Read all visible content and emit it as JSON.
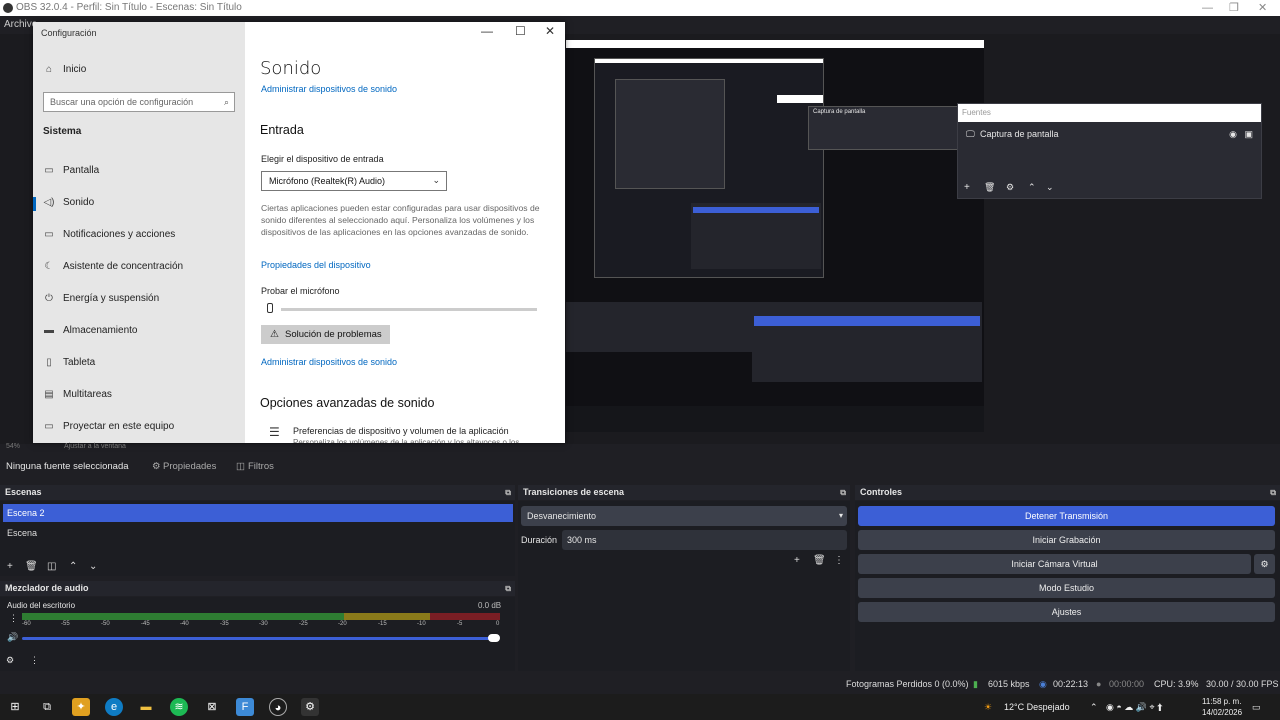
{
  "obs": {
    "window_title": "OBS 32.0.4 - Perfil: Sin Título - Escenas: Sin Título",
    "menu_first": "Archivo",
    "preview_sources_title": "Fuentes",
    "preview_source_item": "Captura de pantalla",
    "no_source": "Ninguna fuente seleccionada",
    "properties": "Propiedades",
    "filters": "Filtros",
    "scale_hint": "54%",
    "fit_hint": "Ajustar a la ventana"
  },
  "settings": {
    "window_title": "Configuración",
    "home": "Inicio",
    "search_placeholder": "Buscar una opción de configuración",
    "section": "Sistema",
    "side_items": [
      {
        "label": "Pantalla",
        "icon": "monitor-icon"
      },
      {
        "label": "Sonido",
        "icon": "speaker-icon"
      },
      {
        "label": "Notificaciones y acciones",
        "icon": "notification-icon"
      },
      {
        "label": "Asistente de concentración",
        "icon": "moon-icon"
      },
      {
        "label": "Energía y suspensión",
        "icon": "power-icon"
      },
      {
        "label": "Almacenamiento",
        "icon": "storage-icon"
      },
      {
        "label": "Tableta",
        "icon": "tablet-icon"
      },
      {
        "label": "Multitareas",
        "icon": "multitask-icon"
      },
      {
        "label": "Proyectar en este equipo",
        "icon": "project-icon"
      }
    ],
    "page_title": "Sonido",
    "manage_devices_top": "Administrar dispositivos de sonido",
    "input_heading": "Entrada",
    "choose_input_label": "Elegir el dispositivo de entrada",
    "input_device": "Micrófono (Realtek(R) Audio)",
    "input_note": "Ciertas aplicaciones pueden estar configuradas para usar dispositivos de sonido diferentes al seleccionado aquí. Personaliza los volúmenes y los dispositivos de las aplicaciones en las opciones avanzadas de sonido.",
    "device_properties": "Propiedades del dispositivo",
    "test_mic": "Probar el micrófono",
    "mic_level": 0.0,
    "troubleshoot": "Solución de problemas",
    "manage_devices_bottom": "Administrar dispositivos de sonido",
    "advanced_heading": "Opciones avanzadas de sonido",
    "app_prefs": "Preferencias de dispositivo y volumen de la aplicación",
    "app_prefs_sub": "Personaliza los volúmenes de la aplicación y los altavoces o los"
  },
  "docks": {
    "scenes_title": "Escenas",
    "scenes": [
      "Escena 2",
      "Escena"
    ],
    "selected_scene": "Escena 2",
    "transitions_title": "Transiciones de escena",
    "transition": "Desvanecimiento",
    "duration_label": "Duración",
    "duration_value": "300 ms",
    "controls_title": "Controles",
    "controls": [
      "Detener Transmisión",
      "Iniciar Grabación",
      "Iniciar Cámara Virtual",
      "Modo Estudio",
      "Ajustes"
    ],
    "mixer_title": "Mezclador de audio",
    "mixer_channel": "Audio del escritorio",
    "mixer_db": "0.0 dB",
    "mixer_ticks": [
      "-60",
      "-55",
      "-50",
      "-45",
      "-40",
      "-35",
      "-30",
      "-25",
      "-20",
      "-15",
      "-10",
      "-5",
      "0"
    ],
    "volume_level": 1.0
  },
  "status": {
    "dropped_frames": "Fotogramas Perdidos 0 (0.0%)",
    "bitrate": "6015 kbps",
    "stream_time": "00:22:13",
    "rec_time": "00:00:00",
    "cpu": "CPU: 3.9%",
    "fps": "30.00 / 30.00 FPS"
  },
  "taskbar": {
    "weather": "12°C  Despejado",
    "time": "11:58 p. m.",
    "date": "14/02/2026"
  },
  "colors": {
    "accent": "#3c5fd6",
    "win_link": "#0067c0",
    "meter_green": "#2e7d32",
    "meter_yellow": "#8a7a1a",
    "meter_red": "#7a1e24"
  }
}
